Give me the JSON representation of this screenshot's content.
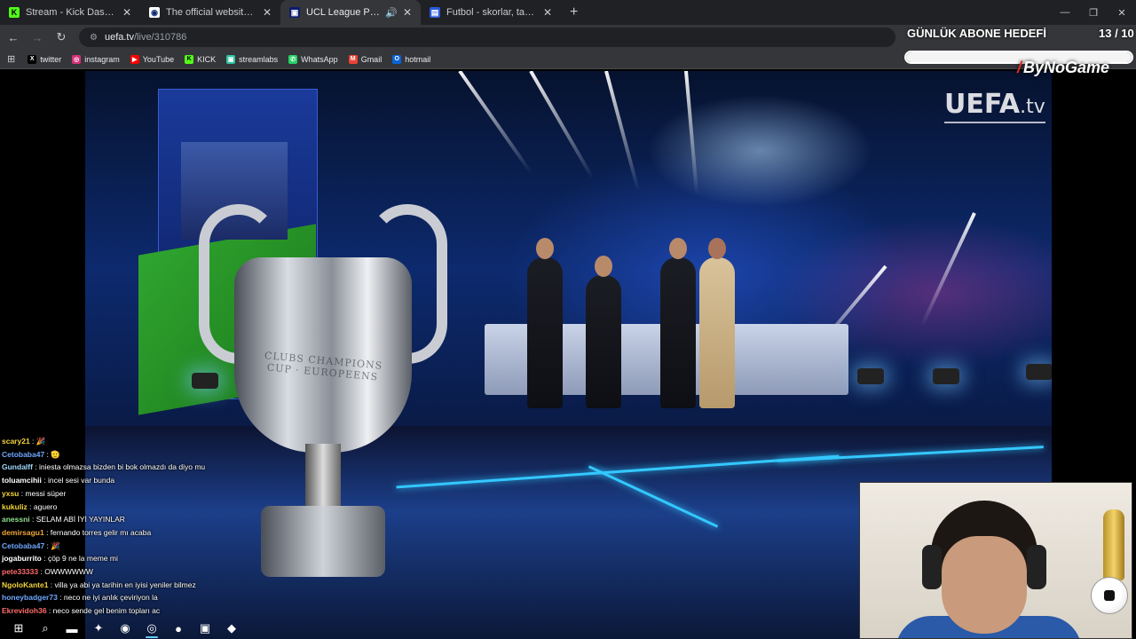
{
  "browser": {
    "tabs": [
      {
        "title": "Stream - Kick Dashboard",
        "icon": "kick-icon",
        "active": false
      },
      {
        "title": "The official website for European",
        "icon": "uefa-icon",
        "active": false
      },
      {
        "title": "UCL League Phase Draw",
        "icon": "uefa-tv-icon",
        "active": true
      },
      {
        "title": "Futbol - skorlar, takvim & oranl",
        "icon": "flashscore-icon",
        "active": false
      }
    ],
    "new_tab": "+",
    "url": {
      "host": "uefa.tv",
      "path": "/live/310786"
    },
    "bookmarks": [
      {
        "label": "twitter",
        "icon": "x-icon",
        "color": "#000000"
      },
      {
        "label": "instagram",
        "icon": "instagram-icon",
        "color": "#d6307a"
      },
      {
        "label": "YouTube",
        "icon": "youtube-icon",
        "color": "#ff0000"
      },
      {
        "label": "KICK",
        "icon": "kick-icon",
        "color": "#53fc18"
      },
      {
        "label": "streamlabs",
        "icon": "streamlabs-icon",
        "color": "#31c3a2"
      },
      {
        "label": "WhatsApp",
        "icon": "whatsapp-icon",
        "color": "#25d366"
      },
      {
        "label": "Gmail",
        "icon": "gmail-icon",
        "color": "#ea4335"
      },
      {
        "label": "hotmail",
        "icon": "outlook-icon",
        "color": "#0a64d8"
      }
    ]
  },
  "video": {
    "logo_main": "UEFA",
    "logo_suffix": ".tv",
    "trophy_engraving": "CLUBS CHAMPIONS CUP · EUROPEENS"
  },
  "overlay": {
    "goal_title": "GÜNLÜK ABONE HEDEFİ",
    "goal_count": "13 / 10",
    "goal_progress": 1.0,
    "brand": "ByNoGame"
  },
  "chat": [
    {
      "user": "scary21",
      "text": "🎉",
      "color": "#f2d33a"
    },
    {
      "user": "Cetobaba47",
      "text": "🫡",
      "color": "#6fa8ff"
    },
    {
      "user": "Gundalff",
      "text": "iniesta olmazsa bizden bi bok olmazdı da diyo mu",
      "color": "#9fd8ff"
    },
    {
      "user": "toluamcihii",
      "text": "incel sesi var bunda",
      "color": "#ffffff"
    },
    {
      "user": "yxsu",
      "text": "messi süper",
      "color": "#f2d33a"
    },
    {
      "user": "kukuliz",
      "text": "aguero",
      "color": "#f2d33a"
    },
    {
      "user": "anessni",
      "text": "SELAM ABİ İYİ YAYINLAR",
      "color": "#8fe08f"
    },
    {
      "user": "demirsagu1",
      "text": "fernando torres gelir mı acaba",
      "color": "#f2a53a"
    },
    {
      "user": "Cetobaba47",
      "text": "🎉",
      "color": "#6fa8ff"
    },
    {
      "user": "jogaburrito",
      "text": "çöp 9 ne la meme mi",
      "color": "#ffffff"
    },
    {
      "user": "pete33333",
      "text": "OWWWWWW",
      "color": "#ff6b6b"
    },
    {
      "user": "NgoloKante1",
      "text": "villa ya abi ya tarihin en iyisi yeniler bilmez",
      "color": "#f2d33a"
    },
    {
      "user": "honeybadger73",
      "text": "neco ne iyi anlık çeviriyon la",
      "color": "#6fa8ff"
    },
    {
      "user": "Ekrevidoh36",
      "text": "neco sende gel benim topları ac",
      "color": "#ff6b6b"
    }
  ],
  "taskbar": [
    {
      "name": "windows-start-icon",
      "glyph": "⊞",
      "active": false
    },
    {
      "name": "search-icon",
      "glyph": "⌕",
      "active": false
    },
    {
      "name": "file-explorer-icon",
      "glyph": "▬",
      "active": false
    },
    {
      "name": "app-icon",
      "glyph": "✦",
      "active": false
    },
    {
      "name": "discord-icon",
      "glyph": "◉",
      "active": false
    },
    {
      "name": "chrome-icon",
      "glyph": "◎",
      "active": true
    },
    {
      "name": "spotify-icon",
      "glyph": "●",
      "active": false
    },
    {
      "name": "streaming-app-icon",
      "glyph": "▣",
      "active": false
    },
    {
      "name": "generic-app-icon",
      "glyph": "◆",
      "active": false
    }
  ]
}
